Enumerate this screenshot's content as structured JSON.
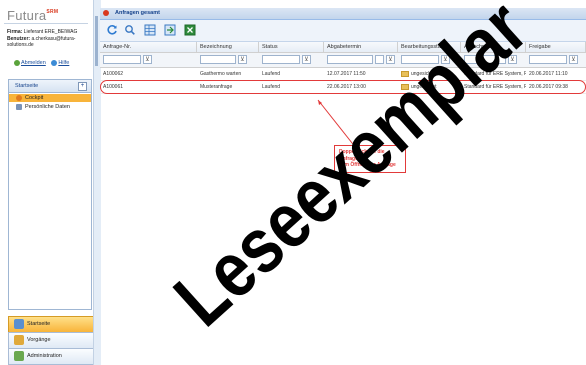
{
  "app": {
    "logo": "Futura",
    "logo_sup": "SRM"
  },
  "company": {
    "label1": "Firma:",
    "value1": "Lieferant ERE_BEIWAG",
    "label2": "Benutzer:",
    "value2": "a.cherkasu@futura-solutions.de"
  },
  "links": {
    "logout": "Abmelden",
    "help": "Hilfe"
  },
  "nav": {
    "title": "Startseite",
    "toggle": "+",
    "items": [
      {
        "label": "Cockpit",
        "selected": true
      },
      {
        "label": "Persönliche Daten",
        "selected": false
      }
    ]
  },
  "bottom_nav": [
    {
      "label": "Startseite",
      "active": true
    },
    {
      "label": "Vorgänge",
      "active": false
    },
    {
      "label": "Administration",
      "active": false
    }
  ],
  "panel": {
    "title": "Anfragen gesamt"
  },
  "grid": {
    "columns": [
      "Anfrage-Nr.",
      "Bezeichnung",
      "Status",
      "Abgabetermin",
      "Bearbeitungsstatus",
      "Ausschreib",
      "Freigabe"
    ],
    "filter_icon": "⊻",
    "rows": [
      {
        "nr": "A100062",
        "bez": "Gasthermo warten",
        "status": "Laufend",
        "termin": "12.07.2017 11:50",
        "bearb": "ungesichtet",
        "aus": "Standard für ERE System, P...",
        "frei": "20.06.2017 11:10"
      },
      {
        "nr": "A100061",
        "bez": "Musteranfrage",
        "status": "Laufend",
        "termin": "22.06.2017 13:00",
        "bearb": "ungesichtet",
        "aus": "Standard für ERE System, P...",
        "frei": "20.06.2017 09:38"
      }
    ]
  },
  "callout": {
    "line1": "Doppelklick auf die Anfrage",
    "line2": "zum Öffnen der Anfrage"
  },
  "watermark": {
    "text": "Leseexemplar"
  },
  "colors": {
    "accent": "#f8b43a",
    "annotation": "#e23a3a",
    "header_blue": "#15428b"
  }
}
